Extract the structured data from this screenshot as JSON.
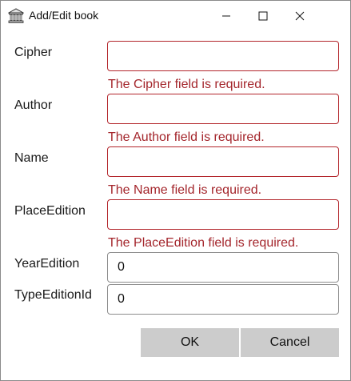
{
  "window": {
    "title": "Add/Edit book"
  },
  "icons": {
    "app": "library-building-icon",
    "minimize": "minimize-icon",
    "maximize": "maximize-icon",
    "close": "close-icon"
  },
  "fields": {
    "cipher": {
      "label": "Cipher",
      "value": "",
      "error": "The Cipher field is required."
    },
    "author": {
      "label": "Author",
      "value": "",
      "error": "The Author field is required."
    },
    "name": {
      "label": "Name",
      "value": "",
      "error": "The Name field is required."
    },
    "place_edition": {
      "label": "PlaceEdition",
      "value": "",
      "error": "The PlaceEdition field is required."
    },
    "year_edition": {
      "label": "YearEdition",
      "value": "0"
    },
    "type_edition_id": {
      "label": "TypeEditionId",
      "value": "0"
    }
  },
  "buttons": {
    "ok": "OK",
    "cancel": "Cancel"
  },
  "colors": {
    "error": "#a4262c",
    "invalid_border": "#b3262c",
    "button_bg": "#cccccc"
  }
}
